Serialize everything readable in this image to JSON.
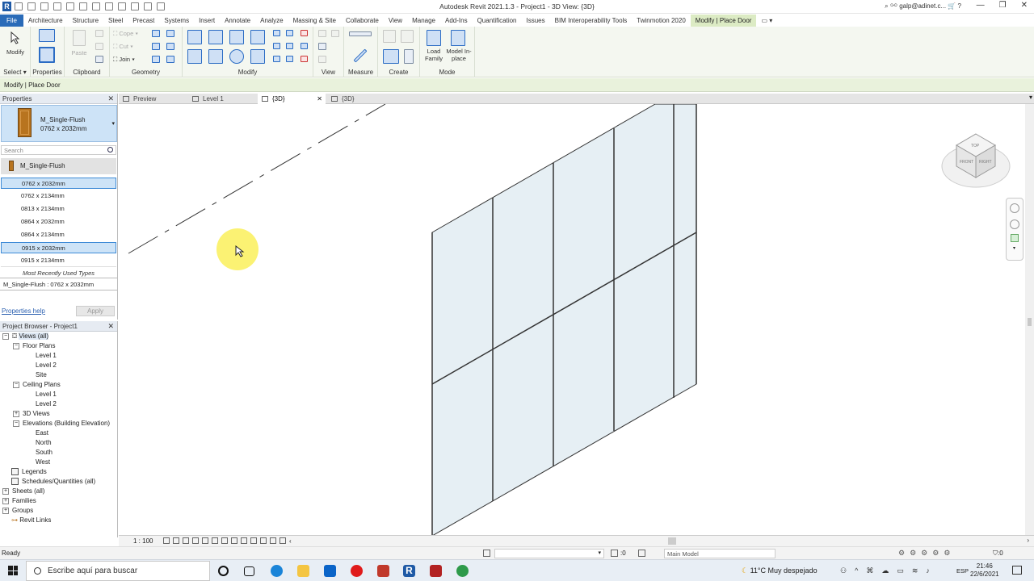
{
  "title_bar": {
    "app_title": "Autodesk Revit 2021.1.3 - Project1 - 3D View: {3D}",
    "user": "galp@adinet.c..."
  },
  "menu_tabs": [
    "File",
    "Architecture",
    "Structure",
    "Steel",
    "Precast",
    "Systems",
    "Insert",
    "Annotate",
    "Analyze",
    "Massing & Site",
    "Collaborate",
    "View",
    "Manage",
    "Add-Ins",
    "Quantification",
    "Issues",
    "BIM Interoperability Tools",
    "Twinmotion 2020",
    "Modify | Place Door"
  ],
  "ribbon": {
    "modify_label": "Modify",
    "select_label": "Select",
    "properties_label": "Properties",
    "clipboard_label": "Clipboard",
    "paste_label": "Paste",
    "cope_label": "Cope",
    "cut_label": "Cut",
    "join_label": "Join",
    "geometry_label": "Geometry",
    "modify_panel_label": "Modify",
    "view_label": "View",
    "measure_label": "Measure",
    "create_label": "Create",
    "load_family_label": "Load Family",
    "model_inplace_label": "Model In-place",
    "mode_label": "Mode"
  },
  "context_bar": "Modify | Place Door",
  "properties": {
    "header": "Properties",
    "family_name": "M_Single-Flush",
    "type_size": "0762 x 2032mm",
    "search_placeholder": "Search",
    "family_row": "M_Single-Flush",
    "sizes": [
      "0762 x 2032mm",
      "0762 x 2134mm",
      "0813 x 2134mm",
      "0864 x 2032mm",
      "0864 x 2134mm",
      "0915 x 2032mm",
      "0915 x 2134mm"
    ],
    "most_recent": "Most Recently Used Types",
    "current_type": "M_Single-Flush : 0762 x 2032mm",
    "help_link": "Properties help",
    "apply": "Apply"
  },
  "project_browser": {
    "header": "Project Browser - Project1",
    "views_all": "Views (all)",
    "floor_plans": "Floor Plans",
    "fp_level1": "Level 1",
    "fp_level2": "Level 2",
    "fp_site": "Site",
    "ceiling_plans": "Ceiling Plans",
    "cp_level1": "Level 1",
    "cp_level2": "Level 2",
    "views_3d": "3D Views",
    "elevations": "Elevations (Building Elevation)",
    "east": "East",
    "north": "North",
    "south": "South",
    "west": "West",
    "legends": "Legends",
    "schedules": "Schedules/Quantities (all)",
    "sheets": "Sheets (all)",
    "families": "Families",
    "groups": "Groups",
    "revit_links": "Revit Links"
  },
  "view_tabs": [
    "Preview",
    "Level 1",
    "{3D}",
    "{3D}"
  ],
  "view_controls": {
    "scale": "1 : 100"
  },
  "status_bar": {
    "status": "Ready",
    "zero": ":0",
    "model": "Main Model"
  },
  "taskbar": {
    "search_placeholder": "Escribe aquí para buscar",
    "weather": "11°C  Muy despejado",
    "lang": "ESP",
    "time": "21:46",
    "date": "22/6/2021"
  },
  "viewcube": {
    "top": "TOP",
    "front": "FRONT",
    "right": "RIGHT"
  },
  "colors": {
    "accent": "#2a6bb8",
    "context_tab": "#dcebc4",
    "selection": "#cde3f7",
    "glass": "#e6eff4"
  }
}
